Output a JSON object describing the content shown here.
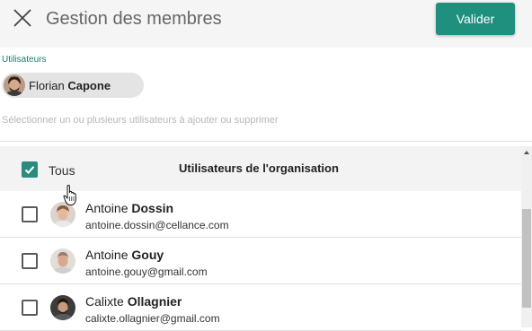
{
  "header": {
    "title": "Gestion des membres",
    "submit_label": "Valider",
    "accent_color": "#1f8f7e"
  },
  "selected": {
    "label": "Utilisateurs",
    "chip": {
      "first_name": "Florian",
      "last_name": "Capone"
    }
  },
  "search": {
    "placeholder": "Sélectionner un ou plusieurs utilisateurs à ajouter ou supprimer"
  },
  "list": {
    "all_label": "Tous",
    "all_checked": true,
    "title": "Utilisateurs de l'organisation",
    "rows": [
      {
        "first_name": "Antoine",
        "last_name": "Dossin",
        "email": "antoine.dossin@cellance.com",
        "checked": false
      },
      {
        "first_name": "Antoine",
        "last_name": "Gouy",
        "email": "antoine.gouy@gmail.com",
        "checked": false
      },
      {
        "first_name": "Calixte",
        "last_name": "Ollagnier",
        "email": "calixte.ollagnier@gmail.com",
        "checked": false
      }
    ]
  },
  "icons": {
    "close": "close-icon",
    "checkmark": "check-icon",
    "cursor": "hand-pointer-icon",
    "scroll_up": "chevron-up-icon"
  }
}
